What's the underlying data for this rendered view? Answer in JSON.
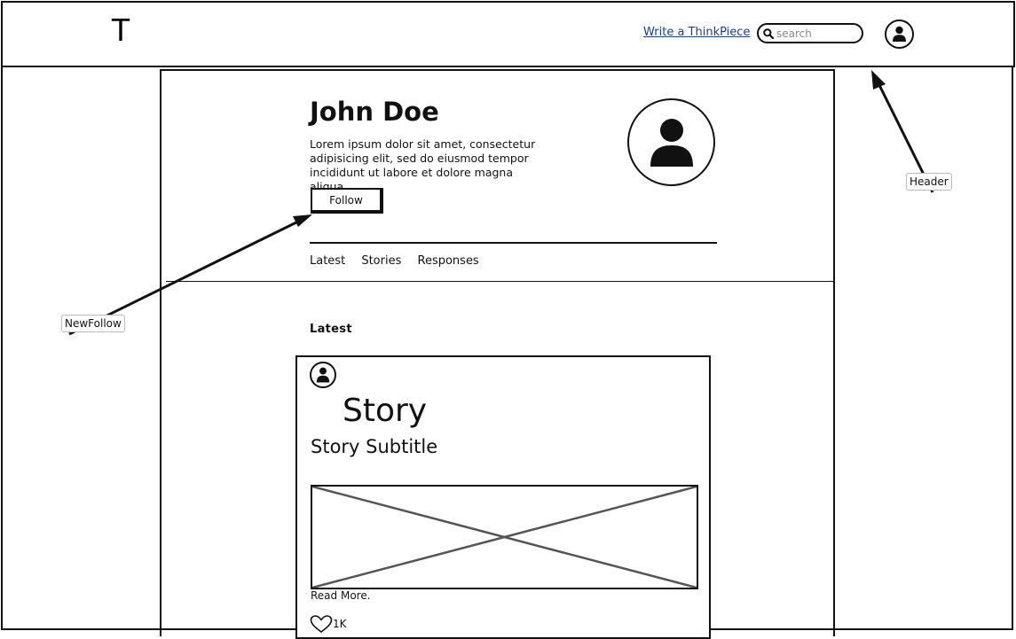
{
  "header": {
    "logo": "T",
    "write_link": "Write a ThinkPiece",
    "search_placeholder": "search",
    "icons": {
      "search": "search-icon",
      "user": "user-icon"
    }
  },
  "profile": {
    "name": "John Doe",
    "bio": "Lorem ipsum dolor sit amet, consectetur adipisicing elit, sed do eiusmod tempor incididunt ut labore et dolore magna aliqua.",
    "follow_label": "Follow"
  },
  "tabs": [
    {
      "label": "Latest"
    },
    {
      "label": "Stories"
    },
    {
      "label": "Responses"
    }
  ],
  "feed": {
    "heading": "Latest",
    "story": {
      "title": "Story",
      "subtitle": "Story Subtitle",
      "read_more": "Read More.",
      "likes": "1K",
      "like_icon": "heart-icon"
    }
  },
  "annotations": {
    "header_note": "Header",
    "follow_note": "NewFollow"
  },
  "colors": {
    "link": "#1a3f8a",
    "ink": "#111111",
    "placeholder_cross": "#555555"
  }
}
